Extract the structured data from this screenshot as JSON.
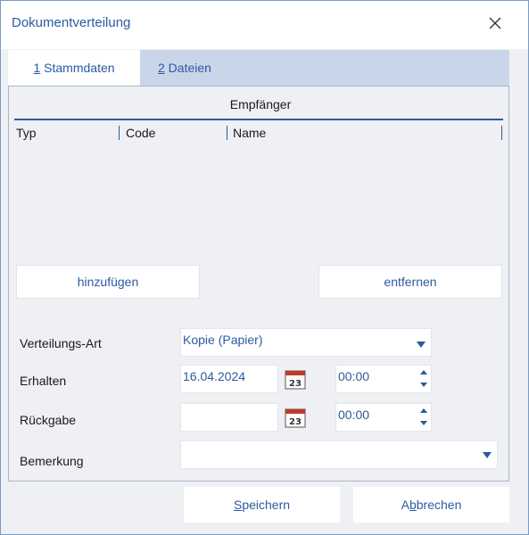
{
  "window": {
    "title": "Dokumentverteilung"
  },
  "tabs": [
    {
      "mnemonic": "1",
      "label": " Stammdaten"
    },
    {
      "mnemonic": "2",
      "label": " Dateien"
    }
  ],
  "recipients": {
    "header": "Empfänger",
    "columns": [
      "Typ",
      "Code",
      "Name"
    ],
    "add_label": "hinzufügen",
    "remove_label": "entfernen"
  },
  "form": {
    "distribution_type": {
      "label": "Verteilungs-Art",
      "value": "Kopie (Papier)"
    },
    "received": {
      "label": "Erhalten",
      "date": "16.04.2024",
      "time": "00:00"
    },
    "return": {
      "label": "Rückgabe",
      "date": "",
      "time": "00:00"
    },
    "remark": {
      "label": "Bemerkung",
      "value": ""
    },
    "calendar_day": "23"
  },
  "footer": {
    "save": {
      "mnemonic": "S",
      "rest": "peichern"
    },
    "cancel": {
      "pre": "A",
      "mnemonic": "b",
      "rest": "brechen"
    }
  },
  "colors": {
    "accent": "#2c5aa0",
    "tab_strip": "#c9d6ea",
    "background": "#eef0f3",
    "calendar_red": "#c0392b"
  }
}
